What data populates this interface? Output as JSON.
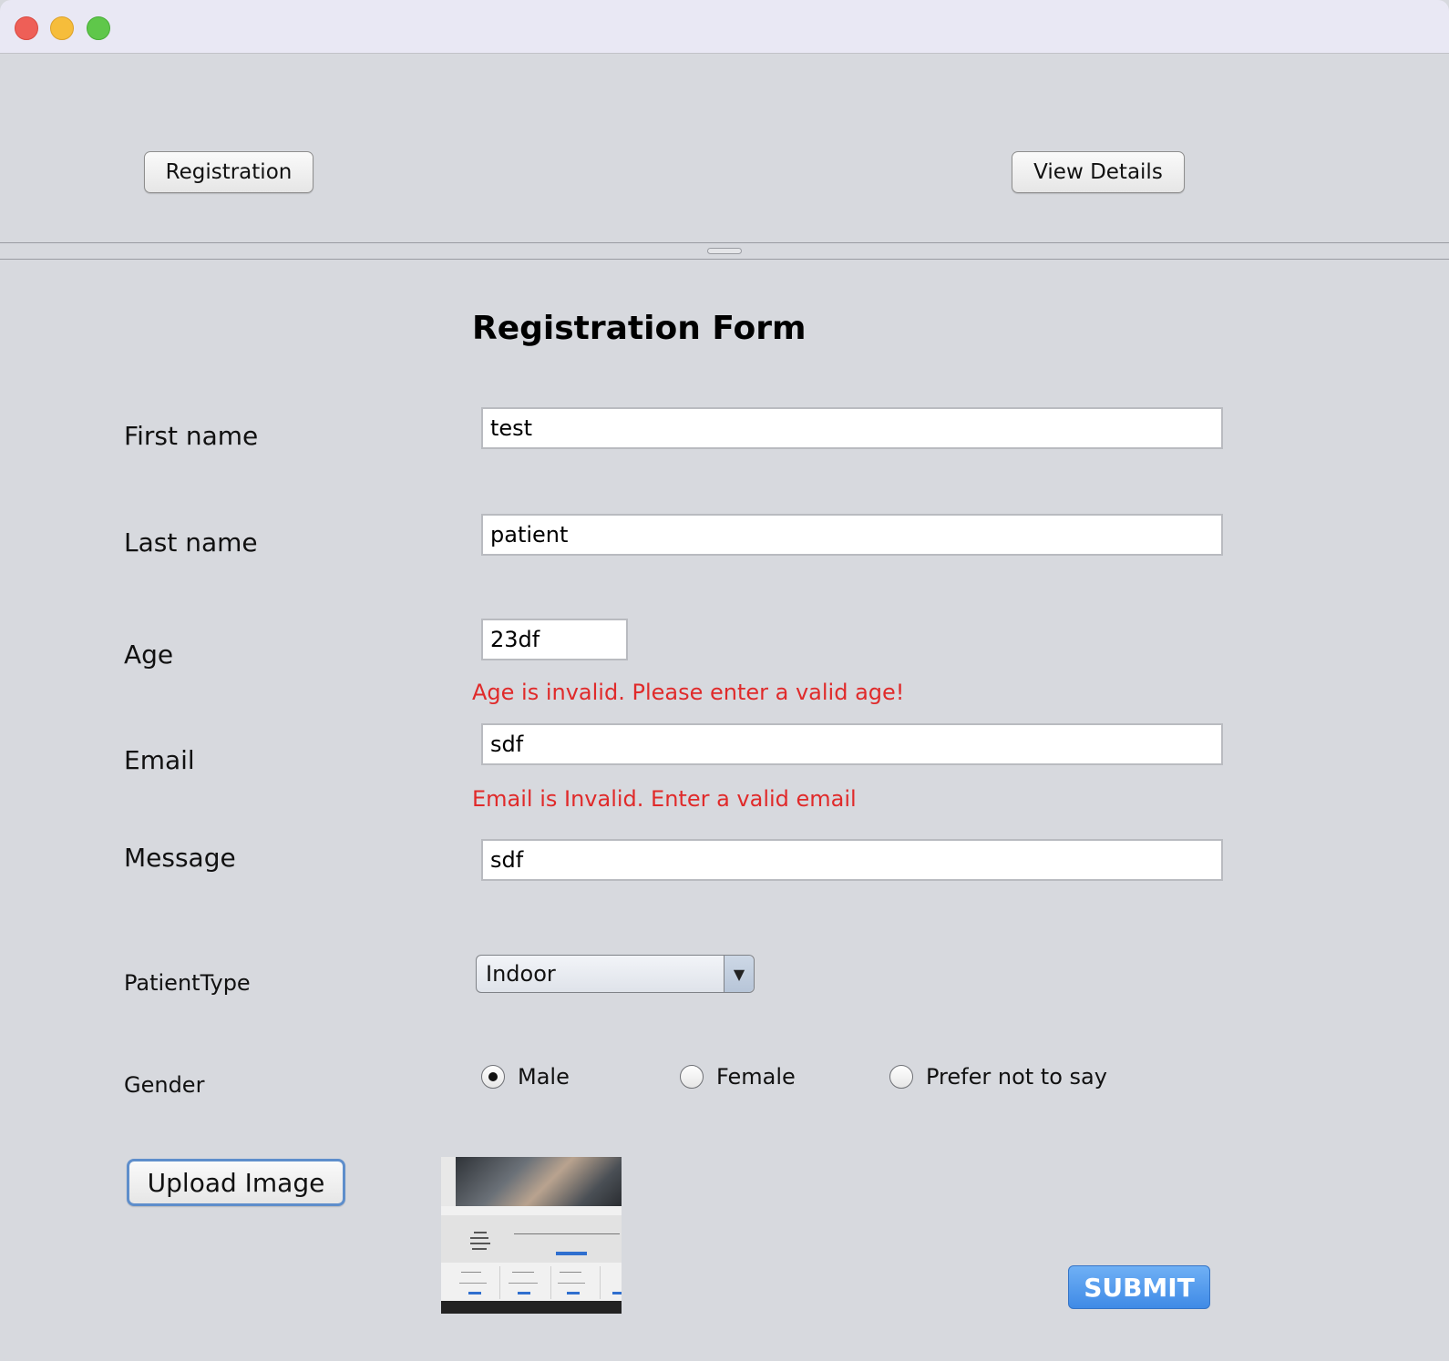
{
  "top_nav": {
    "registration_button": "Registration",
    "view_details_button": "View Details"
  },
  "form": {
    "title": "Registration Form",
    "first_name": {
      "label": "First name",
      "value": "test"
    },
    "last_name": {
      "label": "Last name",
      "value": "patient"
    },
    "age": {
      "label": "Age",
      "value": "23df",
      "error": "Age is invalid. Please enter a valid age!"
    },
    "email": {
      "label": "Email",
      "value": "sdf",
      "error": "Email is Invalid. Enter a valid email"
    },
    "message": {
      "label": "Message",
      "value": "sdf"
    },
    "patient_type": {
      "label": "PatientType",
      "selected": "Indoor"
    },
    "gender": {
      "label": "Gender",
      "options": [
        {
          "label": "Male",
          "checked": true
        },
        {
          "label": "Female",
          "checked": false
        },
        {
          "label": "Prefer not to say",
          "checked": false
        }
      ]
    },
    "upload_button": "Upload Image",
    "submit_button": "SUBMIT"
  },
  "colors": {
    "error": "#e02a2a",
    "submit": "#3f8ae6",
    "background": "#d7d9de"
  }
}
